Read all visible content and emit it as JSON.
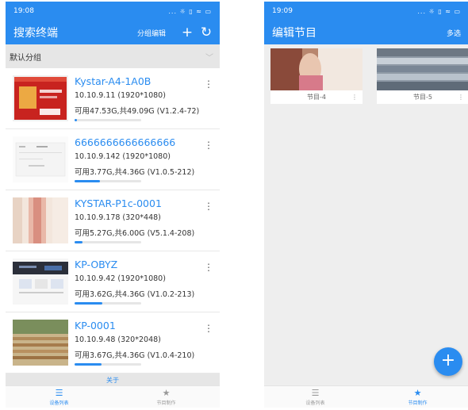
{
  "left": {
    "status": {
      "time": "19:08",
      "icons": "... ☼ ▯ ≈ ▭"
    },
    "appbar": {
      "title": "搜索终端",
      "group_edit": "分组编辑"
    },
    "group": {
      "name": "默认分组"
    },
    "devices": [
      {
        "name": "Kystar-A4-1A0B",
        "ip": "10.10.9.11 (1920*1080)",
        "storage": "可用47.53G,共49.09G (V1.2.4-72)",
        "usage": 0.03
      },
      {
        "name": "6666666666666666",
        "ip": "10.10.9.142 (1920*1080)",
        "storage": "可用3.77G,共4.36G (V1.0.5-212)",
        "usage": 0.38
      },
      {
        "name": "KYSTAR-P1c-0001",
        "ip": "10.10.9.178 (320*448)",
        "storage": "可用5.27G,共6.00G (V5.1.4-208)",
        "usage": 0.12
      },
      {
        "name": "KP-OBYZ",
        "ip": "10.10.9.42 (1920*1080)",
        "storage": "可用3.62G,共4.36G (V1.0.2-213)",
        "usage": 0.42
      },
      {
        "name": "KP-0001",
        "ip": "10.10.9.48 (320*2048)",
        "storage": "可用3.67G,共4.36G (V1.0.4-210)",
        "usage": 0.4
      }
    ],
    "about": "关于",
    "tabs": [
      {
        "label": "设备列表"
      },
      {
        "label": "节目制作"
      }
    ]
  },
  "right": {
    "status": {
      "time": "19:09",
      "icons": "... ☼ ▯ ≈ ▭"
    },
    "appbar": {
      "title": "编辑节目",
      "multi_select": "多选"
    },
    "programs": [
      {
        "label": "节目-4"
      },
      {
        "label": "节目-5"
      }
    ],
    "tabs": [
      {
        "label": "设备列表"
      },
      {
        "label": "节目制作"
      }
    ]
  },
  "colors": {
    "accent": "#2a8cf0"
  }
}
